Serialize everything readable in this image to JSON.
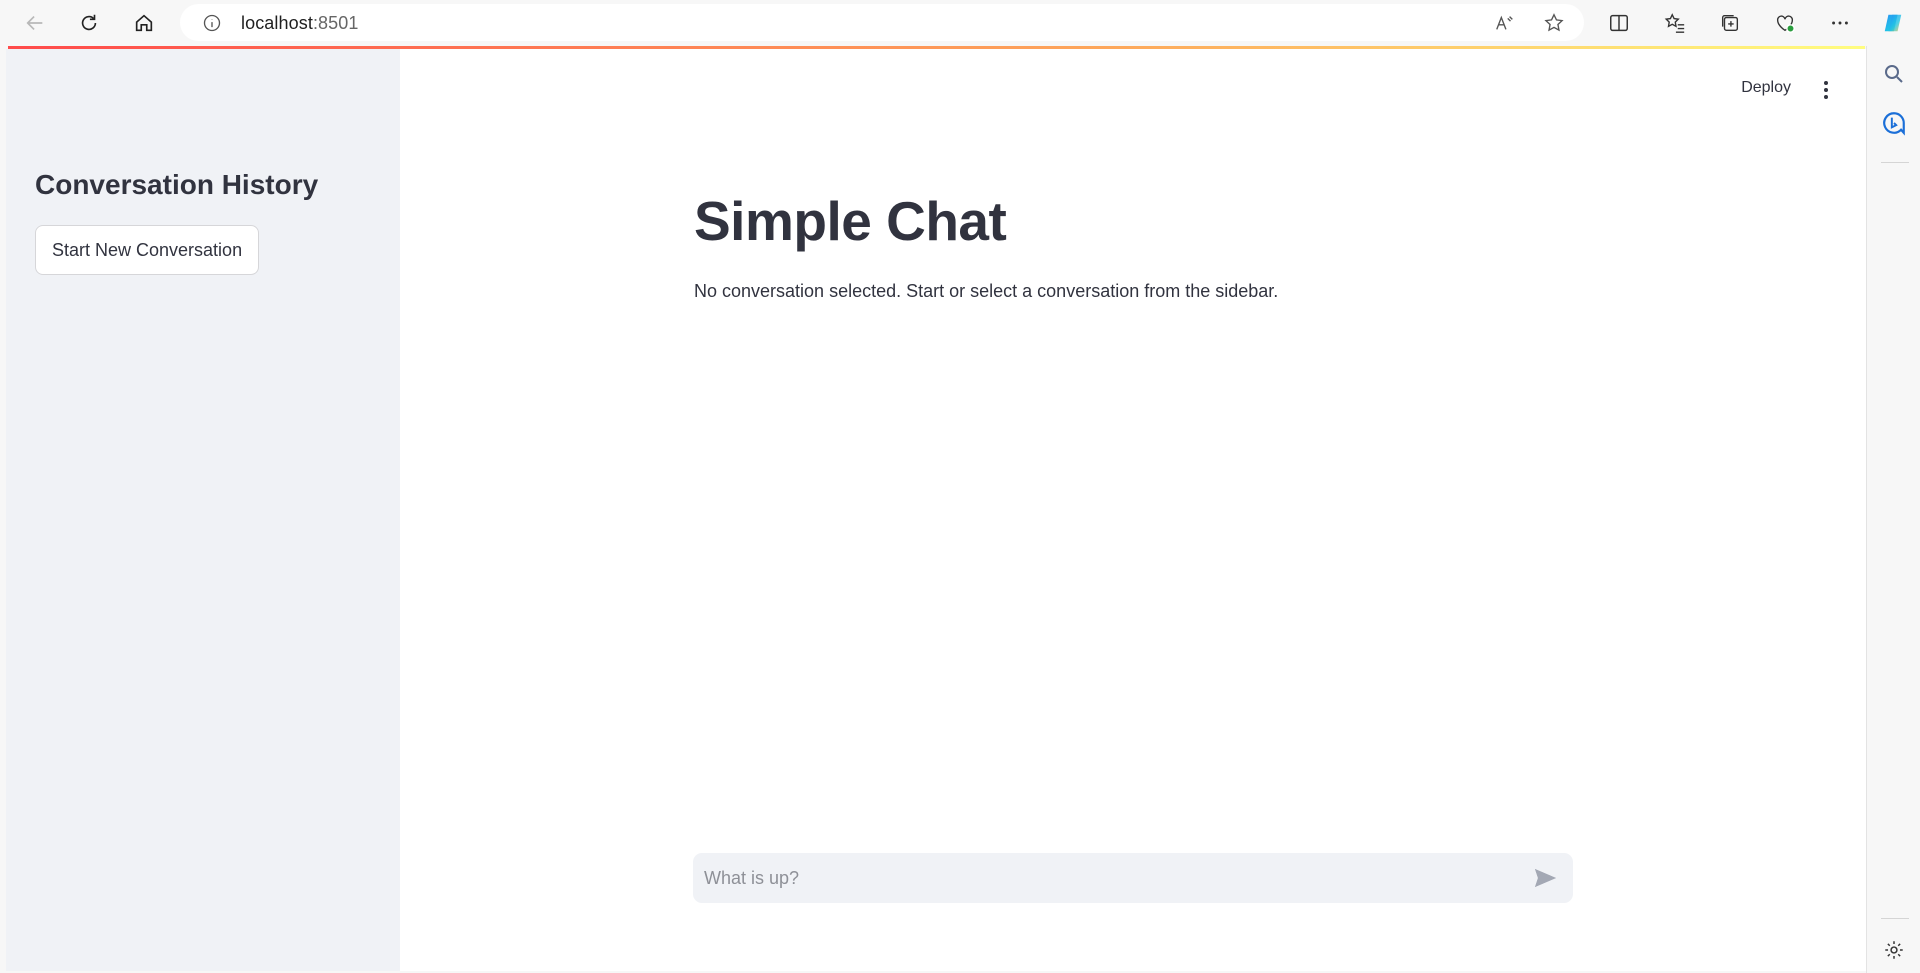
{
  "browser": {
    "url_host": "localhost",
    "url_port": ":8501"
  },
  "sidebar": {
    "title": "Conversation History",
    "new_conversation_label": "Start New Conversation"
  },
  "header": {
    "deploy_label": "Deploy"
  },
  "main": {
    "title": "Simple Chat",
    "empty_message": "No conversation selected. Start or select a conversation from the sidebar."
  },
  "chat": {
    "placeholder": "What is up?"
  },
  "colors": {
    "sidebar_bg": "#f0f2f6",
    "text": "#31333f",
    "accent_start": "#ff4b4b",
    "accent_end": "#fffd80"
  }
}
